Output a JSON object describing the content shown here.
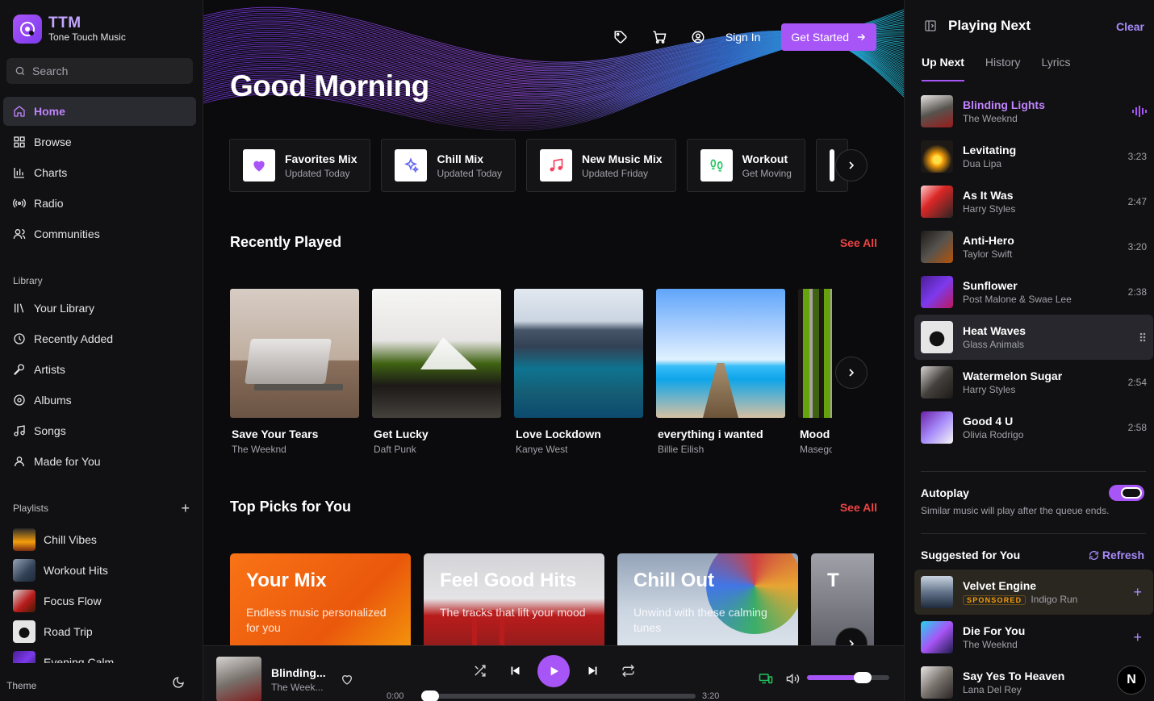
{
  "brand": {
    "name": "TTM",
    "subtitle": "Tone Touch Music"
  },
  "search": {
    "placeholder": "Search"
  },
  "nav": [
    {
      "label": "Home",
      "icon": "home-icon",
      "active": true
    },
    {
      "label": "Browse",
      "icon": "grid-icon"
    },
    {
      "label": "Charts",
      "icon": "bar-chart-icon"
    },
    {
      "label": "Radio",
      "icon": "radio-icon"
    },
    {
      "label": "Communities",
      "icon": "users-icon"
    }
  ],
  "library": {
    "label": "Library",
    "items": [
      {
        "label": "Your Library",
        "icon": "library-icon"
      },
      {
        "label": "Recently Added",
        "icon": "clock-icon"
      },
      {
        "label": "Artists",
        "icon": "mic-icon"
      },
      {
        "label": "Albums",
        "icon": "disc-icon"
      },
      {
        "label": "Songs",
        "icon": "music-note-icon"
      },
      {
        "label": "Made for You",
        "icon": "user-icon"
      }
    ]
  },
  "playlists": {
    "label": "Playlists",
    "add": "+",
    "items": [
      {
        "label": "Chill Vibes"
      },
      {
        "label": "Workout Hits"
      },
      {
        "label": "Focus Flow"
      },
      {
        "label": "Road Trip"
      },
      {
        "label": "Evening Calm"
      }
    ]
  },
  "theme": {
    "label": "Theme"
  },
  "topbar": {
    "signin": "Sign In",
    "get_started": "Get Started"
  },
  "greeting": "Good Morning",
  "mixes": [
    {
      "title": "Favorites Mix",
      "sub": "Updated Today",
      "icon": "heart-icon",
      "color": "#a855f7"
    },
    {
      "title": "Chill Mix",
      "sub": "Updated Today",
      "icon": "sparkles-icon",
      "color": "#6366f1"
    },
    {
      "title": "New Music Mix",
      "sub": "Updated Friday",
      "icon": "music-note-icon",
      "color": "#f43f5e"
    },
    {
      "title": "Workout",
      "sub": "Get Moving",
      "icon": "footprints-icon",
      "color": "#22c55e"
    }
  ],
  "recently_played": {
    "title": "Recently Played",
    "see_all": "See All",
    "items": [
      {
        "title": "Save Your Tears",
        "artist": "The Weeknd"
      },
      {
        "title": "Get Lucky",
        "artist": "Daft Punk"
      },
      {
        "title": "Love Lockdown",
        "artist": "Kanye West"
      },
      {
        "title": "everything i wanted",
        "artist": "Billie Eilish"
      },
      {
        "title": "Mood",
        "artist": "Masego"
      }
    ]
  },
  "top_picks": {
    "title": "Top Picks for You",
    "see_all": "See All",
    "items": [
      {
        "title": "Your Mix",
        "sub": "Endless music personalized for you"
      },
      {
        "title": "Feel Good Hits",
        "sub": "The tracks that lift your mood"
      },
      {
        "title": "Chill Out",
        "sub": "Unwind with these calming tunes"
      },
      {
        "title": "T",
        "sub": ""
      }
    ]
  },
  "player": {
    "title": "Blinding...",
    "artist": "The Week...",
    "elapsed": "0:00",
    "duration": "3:20",
    "progress": 0.0,
    "volume": 0.68
  },
  "right_panel": {
    "title": "Playing Next",
    "clear": "Clear",
    "tabs": [
      "Up Next",
      "History",
      "Lyrics"
    ],
    "queue": [
      {
        "title": "Blinding Lights",
        "artist": "The Weeknd",
        "duration": "",
        "playing": true
      },
      {
        "title": "Levitating",
        "artist": "Dua Lipa",
        "duration": "3:23"
      },
      {
        "title": "As It Was",
        "artist": "Harry Styles",
        "duration": "2:47"
      },
      {
        "title": "Anti-Hero",
        "artist": "Taylor Swift",
        "duration": "3:20"
      },
      {
        "title": "Sunflower",
        "artist": "Post Malone & Swae Lee",
        "duration": "2:38"
      },
      {
        "title": "Heat Waves",
        "artist": "Glass Animals",
        "duration": "",
        "highlight": true
      },
      {
        "title": "Watermelon Sugar",
        "artist": "Harry Styles",
        "duration": "2:54"
      },
      {
        "title": "Good 4 U",
        "artist": "Olivia Rodrigo",
        "duration": "2:58"
      }
    ],
    "autoplay": {
      "label": "Autoplay",
      "sub": "Similar music will play after the queue ends.",
      "on": true
    },
    "suggested": {
      "title": "Suggested for You",
      "refresh": "Refresh",
      "items": [
        {
          "title": "Velvet Engine",
          "badge": "SPONSORED",
          "artist": "Indigo Run"
        },
        {
          "title": "Die For You",
          "artist": "The Weeknd"
        },
        {
          "title": "Say Yes To Heaven",
          "artist": "Lana Del Rey"
        }
      ]
    },
    "n_button": "N"
  }
}
